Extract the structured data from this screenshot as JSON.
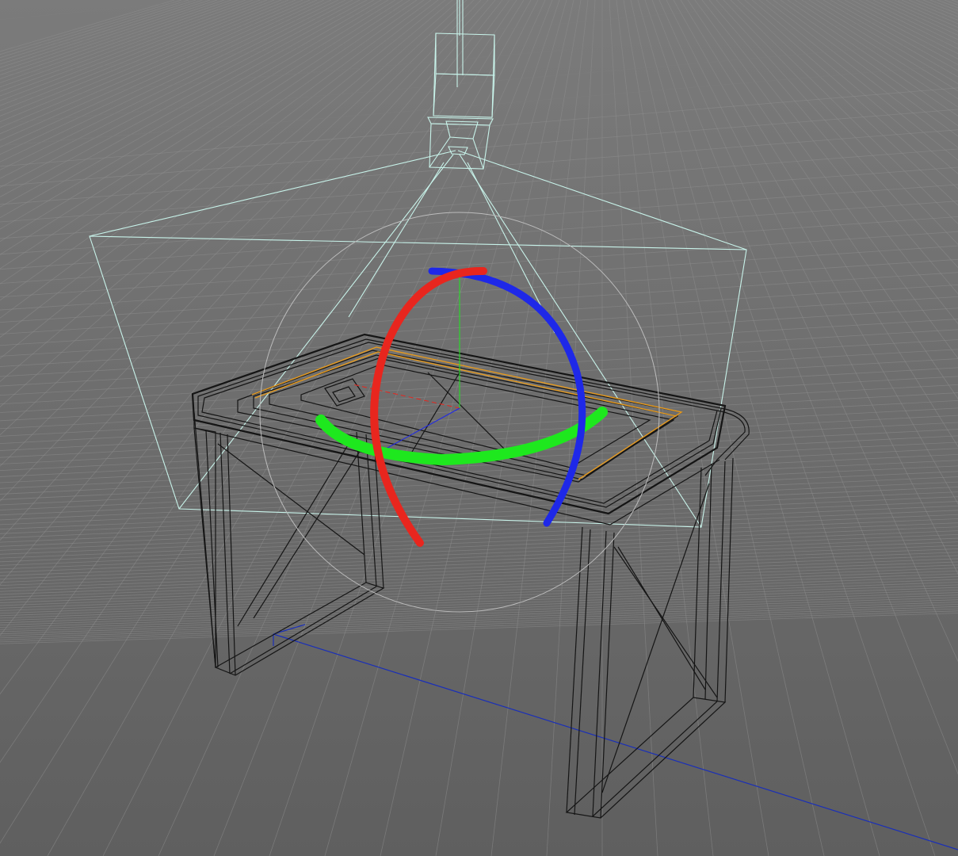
{
  "viewport": {
    "projection": "perspective",
    "shading": "wireframe",
    "background_color": "#6a6a6a",
    "grid_color": "#8f8f8f",
    "grid_horizon_color": "#7d7d7d"
  },
  "scene": {
    "objects": [
      {
        "name": "table",
        "type": "mesh",
        "display": "wireframe",
        "color": "#151515"
      },
      {
        "name": "spot-light",
        "type": "light",
        "color": "#c8f3ea"
      }
    ],
    "selection_highlight_color": "#e69a1e"
  },
  "gizmo": {
    "tool": "rotate",
    "axes": [
      {
        "axis": "x",
        "color": "#e8261e"
      },
      {
        "axis": "y",
        "color": "#1ee81e"
      },
      {
        "axis": "z",
        "color": "#1e28e8"
      }
    ],
    "trackball_color": "#bcbcbc"
  },
  "world_axis": {
    "z_line_color": "#1a2fb8"
  }
}
